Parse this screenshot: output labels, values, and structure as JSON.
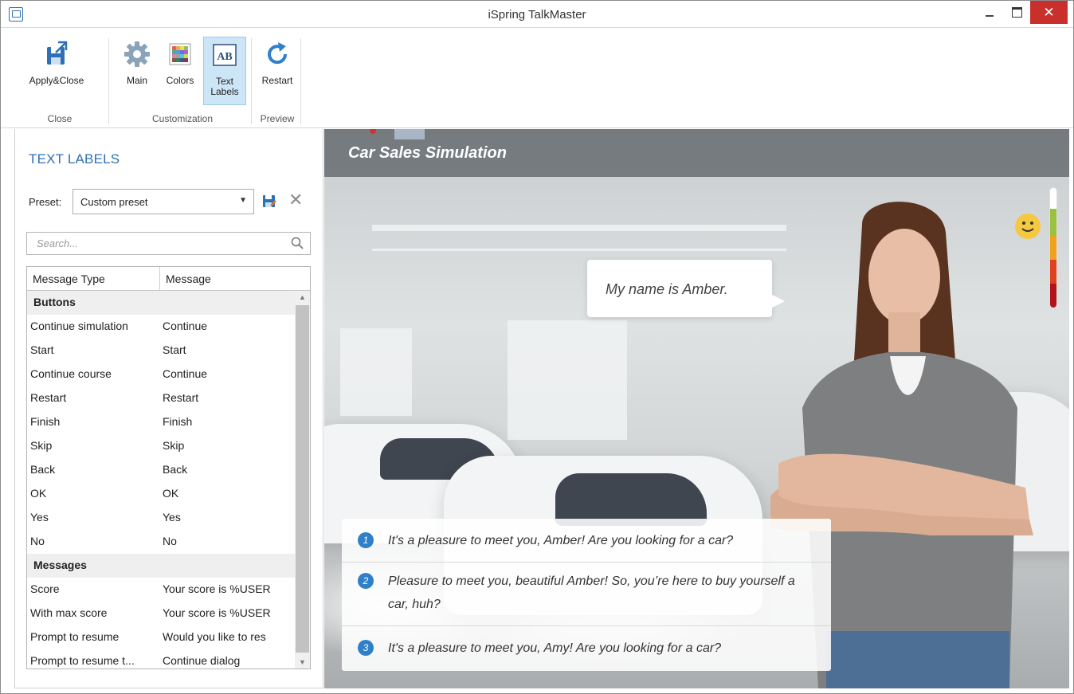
{
  "window": {
    "title": "iSpring TalkMaster"
  },
  "ribbon": {
    "groups": [
      {
        "label": "Close",
        "buttons": [
          "Apply&Close"
        ]
      },
      {
        "label": "Customization",
        "buttons": [
          "Main",
          "Colors",
          "Text Labels"
        ]
      },
      {
        "label": "Preview",
        "buttons": [
          "Restart"
        ]
      }
    ],
    "apply_close": "Apply&Close",
    "main": "Main",
    "colors": "Colors",
    "text_labels_1": "Text",
    "text_labels_2": "Labels",
    "restart": "Restart",
    "group_close": "Close",
    "group_customization": "Customization",
    "group_preview": "Preview",
    "active_button": "Text Labels"
  },
  "panel": {
    "title": "TEXT LABELS",
    "preset_label": "Preset:",
    "preset_value": "Custom preset",
    "search_placeholder": "Search...",
    "columns": [
      "Message Type",
      "Message"
    ],
    "groups": [
      {
        "name": "Buttons",
        "rows": [
          [
            "Continue simulation",
            "Continue"
          ],
          [
            "Start",
            "Start"
          ],
          [
            "Continue course",
            "Continue"
          ],
          [
            "Restart",
            "Restart"
          ],
          [
            "Finish",
            "Finish"
          ],
          [
            "Skip",
            "Skip"
          ],
          [
            "Back",
            "Back"
          ],
          [
            "OK",
            "OK"
          ],
          [
            "Yes",
            "Yes"
          ],
          [
            "No",
            "No"
          ]
        ]
      },
      {
        "name": "Messages",
        "rows": [
          [
            "Score",
            "Your score is %USER"
          ],
          [
            "With max score",
            "Your score is %USER"
          ],
          [
            "Prompt to resume",
            "Would you like to res"
          ],
          [
            "Prompt to resume t...",
            "Continue dialog"
          ]
        ]
      }
    ]
  },
  "preview": {
    "title": "Car Sales Simulation",
    "speech": "My name is Amber.",
    "answers": [
      {
        "num": "1",
        "text": "It's a pleasure to meet you, Amber!  Are you looking for a car?"
      },
      {
        "num": "2",
        "text": "Pleasure to meet you, beautiful Amber! So, you’re here to buy yourself a car, huh?"
      },
      {
        "num": "3",
        "text": "It's a pleasure to meet you, Amy!  Are you looking for a car?"
      }
    ],
    "meter_colors": [
      "#ffffff",
      "#9bc23c",
      "#f2a11f",
      "#e0421f",
      "#b3141b"
    ]
  }
}
